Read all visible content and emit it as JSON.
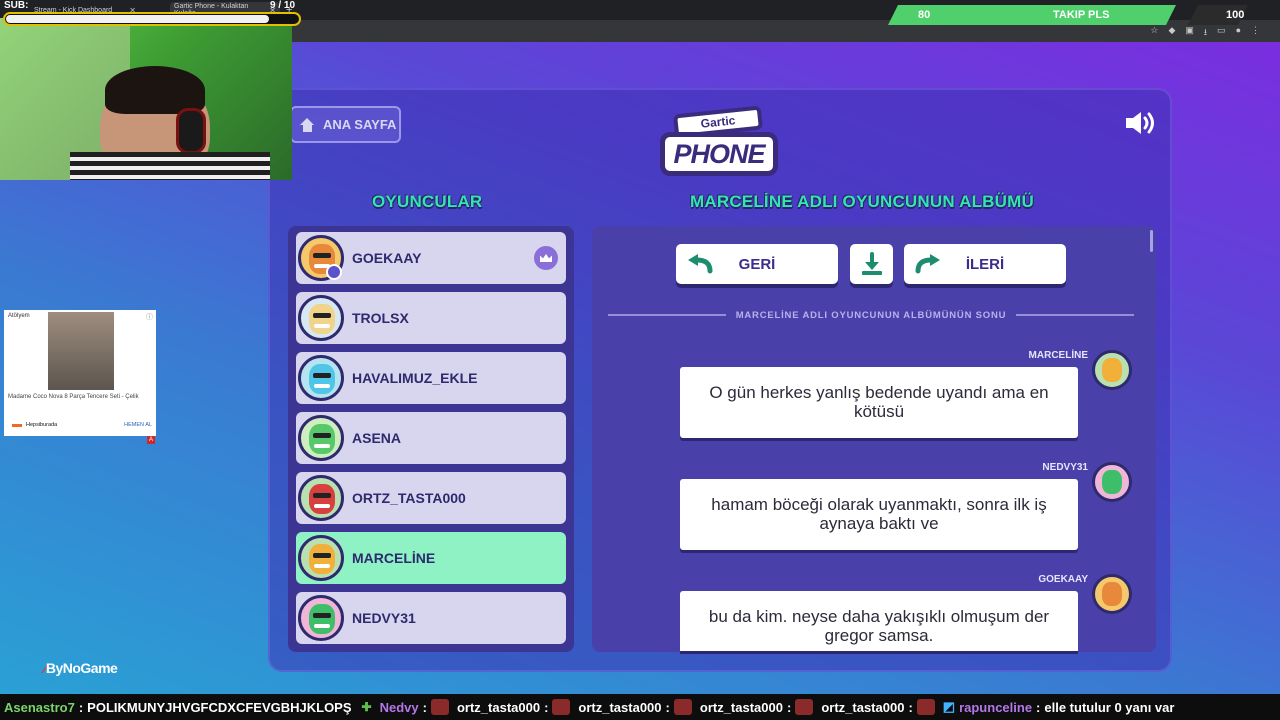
{
  "browser": {
    "tabs": [
      {
        "label": "Stream - Kick Dashboard"
      },
      {
        "label": "Gartic Phone - Kulaktan Kulağa"
      }
    ],
    "new_tab": "+"
  },
  "overlay": {
    "sub_goal": {
      "label": "SUB:",
      "count": "9 / 10",
      "progress": 0.9
    },
    "follow_goal": {
      "current": "80",
      "label": "TAKIP PLS",
      "target": "100",
      "progress": 0.8
    },
    "watermark": "ByNoGame"
  },
  "ad": {
    "brand": "Atölyem",
    "title": "Madame Coco Nova 8 Parça Tencere Seti - Çelik",
    "shop": "Hepsiburada",
    "cta": "HEMEN AL",
    "mark": "A"
  },
  "game": {
    "home_label": "ANA SAYFA",
    "logo_top": "Gartic",
    "logo_main": "PHONE",
    "players_title": "OYUNCULAR",
    "album_title": "MARCELİNE ADLI OYUNCUNUN ALBÜMÜ",
    "back_label": "GERİ",
    "next_label": "İLERİ",
    "album_end": "MARCELİNE ADLI OYUNCUNUN ALBÜMÜNÜN SONU",
    "players": [
      {
        "name": "GOEKAAY",
        "color": "#e8883a",
        "host": true
      },
      {
        "name": "TROLSX",
        "color": "#f2d38a",
        "host": false
      },
      {
        "name": "HAVALIMUZ_EKLE",
        "color": "#4fc6e8",
        "host": false
      },
      {
        "name": "ASENA",
        "color": "#58c96b",
        "host": false
      },
      {
        "name": "ORTZ_TASTA000",
        "color": "#d8403f",
        "host": false
      },
      {
        "name": "MARCELİNE",
        "color": "#f0b03a",
        "host": false,
        "active": true
      },
      {
        "name": "NEDVY31",
        "color": "#3fbe6a",
        "host": false
      }
    ],
    "entries": [
      {
        "author": "MARCELİNE",
        "text": "O gün herkes yanlış bedende uyandı ama en kötüsü",
        "color": "#f0b03a"
      },
      {
        "author": "NEDVY31",
        "text": "hamam böceği olarak uyanmaktı, sonra ilk iş aynaya baktı ve",
        "color": "#3fbe6a"
      },
      {
        "author": "GOEKAAY",
        "text": "bu da kim. neyse daha yakışıklı olmuşum der gregor samsa.",
        "color": "#e8883a"
      }
    ]
  },
  "ticker": [
    {
      "name": "Asenastro7",
      "sep": ":",
      "msg": "POLIKMUNYJHVGFCDXCFEVGBHJKLOPŞ"
    },
    {
      "name": "Nedvy",
      "sep": ":",
      "msg": ""
    },
    {
      "name": "ortz_tasta000",
      "sep": ":",
      "msg": ""
    },
    {
      "name": "ortz_tasta000",
      "sep": ":",
      "msg": ""
    },
    {
      "name": "ortz_tasta000",
      "sep": ":",
      "msg": ""
    },
    {
      "name": "ortz_tasta000",
      "sep": ":",
      "msg": ""
    },
    {
      "name": "rapunceline",
      "sep": ":",
      "msg": "elle tutulur 0 yanı var"
    }
  ]
}
